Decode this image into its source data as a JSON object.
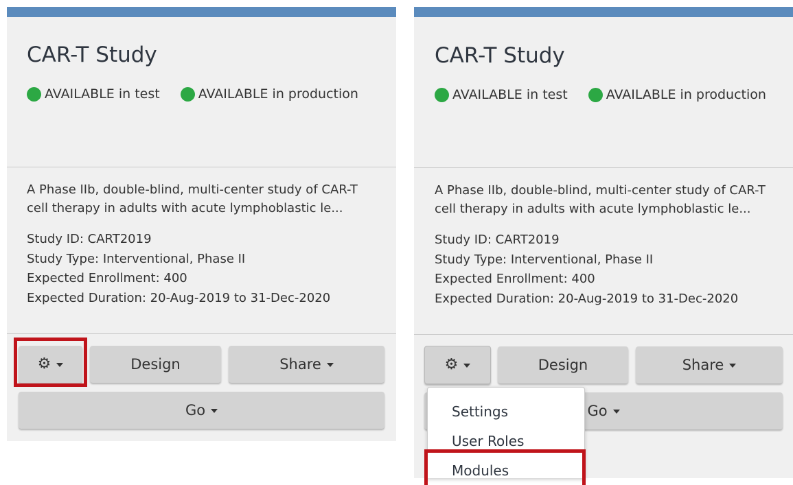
{
  "cards": [
    {
      "title": "CAR-T Study",
      "status": [
        {
          "label": "AVAILABLE in test",
          "color": "#2ca844"
        },
        {
          "label": "AVAILABLE in production",
          "color": "#2ca844"
        }
      ],
      "description": "A Phase IIb, double-blind, multi-center study of CAR-T cell therapy in adults with acute lymphoblastic le...",
      "details": [
        "Study ID: CART2019",
        "Study Type: Interventional, Phase II",
        "Expected Enrollment: 400",
        "Expected Duration: 20-Aug-2019 to 31-Dec-2020"
      ],
      "buttons": {
        "gear_icon": "gear-icon",
        "design": "Design",
        "share": "Share",
        "go": "Go"
      }
    },
    {
      "title": "CAR-T Study",
      "status": [
        {
          "label": "AVAILABLE in test",
          "color": "#2ca844"
        },
        {
          "label": "AVAILABLE in production",
          "color": "#2ca844"
        }
      ],
      "description": "A Phase IIb, double-blind, multi-center study of CAR-T cell therapy in adults with acute lymphoblastic le...",
      "details": [
        "Study ID: CART2019",
        "Study Type: Interventional, Phase II",
        "Expected Enrollment: 400",
        "Expected Duration: 20-Aug-2019 to 31-Dec-2020"
      ],
      "buttons": {
        "gear_icon": "gear-icon",
        "design": "Design",
        "share": "Share",
        "go": "Go"
      },
      "dropdown": {
        "items": [
          "Settings",
          "User Roles",
          "Modules"
        ]
      }
    }
  ],
  "colors": {
    "header_bar": "#5b8bbd",
    "card_background": "#f0f0f0",
    "button_background": "#d3d3d3",
    "highlight": "#c0141b"
  }
}
